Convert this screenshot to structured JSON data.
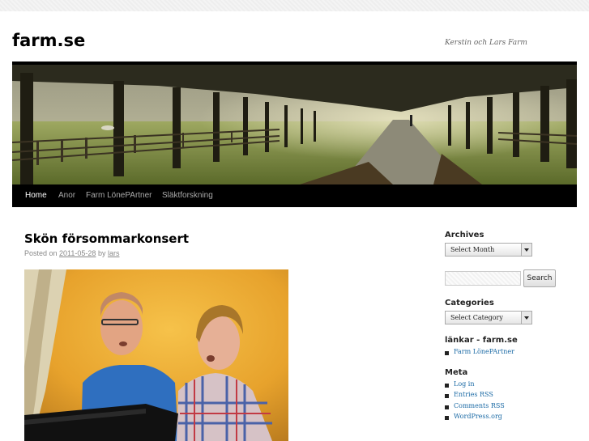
{
  "site": {
    "title": "farm.se",
    "description": "Kerstin och Lars Farm"
  },
  "menu": {
    "items": [
      {
        "label": "Home",
        "current": true
      },
      {
        "label": "Anor",
        "current": false
      },
      {
        "label": "Farm LönePArtner",
        "current": false
      },
      {
        "label": "Släktforskning",
        "current": false
      }
    ]
  },
  "post": {
    "title": "Skön försommarkonsert",
    "posted_on_label": "Posted on",
    "date": "2011-05-28",
    "by_label": "by",
    "author": "lars"
  },
  "sidebar": {
    "archives": {
      "title": "Archives",
      "select_value": "Select Month"
    },
    "search": {
      "value": "",
      "button_label": "Search"
    },
    "categories": {
      "title": "Categories",
      "select_value": "Select Category"
    },
    "links": {
      "title": "länkar - farm.se",
      "items": [
        "Farm LönePArtner"
      ]
    },
    "meta": {
      "title": "Meta",
      "items": [
        "Log in",
        "Entries RSS",
        "Comments RSS",
        "WordPress.org"
      ]
    }
  },
  "colors": {
    "link": "#1b6aa5",
    "menu_bg": "#000000",
    "menu_current": "#ffffff",
    "menu_text": "#aaaaaa"
  },
  "icons": {
    "select_arrow": "chevron-down-icon",
    "list_bullet": "square-bullet-icon"
  }
}
